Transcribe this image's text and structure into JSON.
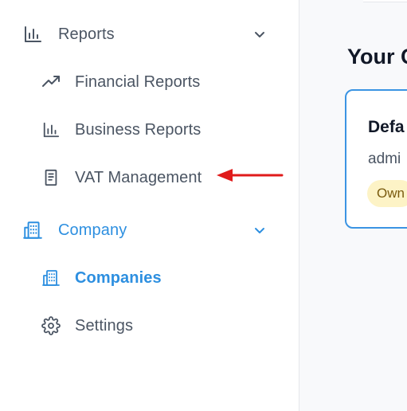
{
  "sidebar": {
    "reports": {
      "label": "Reports",
      "icon": "bar-chart-icon",
      "expanded": true,
      "color": "#4b5563",
      "items": [
        {
          "label": "Financial Reports",
          "icon": "trending-up-icon"
        },
        {
          "label": "Business Reports",
          "icon": "bar-chart-icon"
        },
        {
          "label": "VAT Management",
          "icon": "receipt-icon"
        }
      ]
    },
    "company": {
      "label": "Company",
      "icon": "building-icon",
      "expanded": true,
      "color": "#2d8fe0",
      "items": [
        {
          "label": "Companies",
          "icon": "building-icon",
          "active": true
        },
        {
          "label": "Settings",
          "icon": "gear-icon"
        }
      ]
    }
  },
  "annotation": {
    "icon": "red-arrow-icon",
    "color": "#e01b1b"
  },
  "main": {
    "heading": "Your C",
    "card": {
      "title": "Defa",
      "subtitle": "admi",
      "badge": "Own",
      "border_color": "#3b94e3"
    }
  }
}
